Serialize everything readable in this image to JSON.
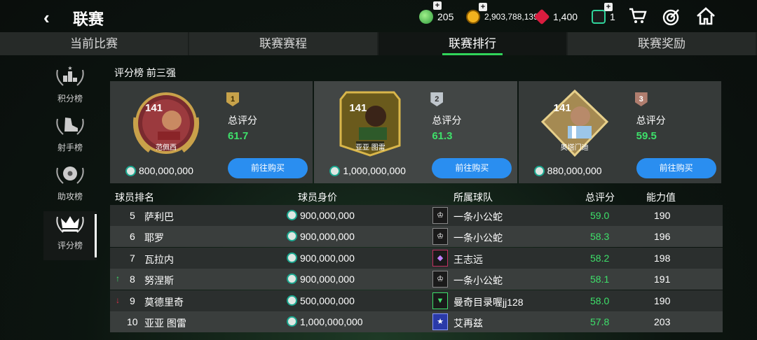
{
  "header": {
    "back_icon": "‹",
    "title": "联赛",
    "currencies": [
      {
        "icon": "gem-green-icon",
        "value": "205",
        "color": "#3fbf55"
      },
      {
        "icon": "coin-gold-icon",
        "value": "2,903,788,139",
        "color": "#e6a21a"
      },
      {
        "icon": "gem-red-icon",
        "value": "1,400",
        "color": "#e02244"
      },
      {
        "icon": "token-green-icon",
        "value": "1",
        "color": "#2fd39a"
      }
    ],
    "plus": "+"
  },
  "tabs": [
    {
      "label": "当前比赛"
    },
    {
      "label": "联赛赛程"
    },
    {
      "label": "联赛排行"
    },
    {
      "label": "联赛奖励"
    }
  ],
  "sidebar": [
    {
      "label": "积分榜",
      "icon": "podium-icon"
    },
    {
      "label": "射手榜",
      "icon": "boot-icon"
    },
    {
      "label": "助攻榜",
      "icon": "ball-icon"
    },
    {
      "label": "评分榜",
      "icon": "crown-icon"
    }
  ],
  "panel": {
    "title": "评分榜 前三强"
  },
  "top3": [
    {
      "rank": "1",
      "rating": "141",
      "name": "范佩西",
      "score_label": "总评分",
      "score": "61.7",
      "price": "800,000,000",
      "buy": "前往购买",
      "badge_color": "#c7a24a"
    },
    {
      "rank": "2",
      "rating": "141",
      "name": "亚亚 图雷",
      "score_label": "总评分",
      "score": "61.3",
      "price": "1,000,000,000",
      "buy": "前往购买",
      "badge_color": "#bfc6cc"
    },
    {
      "rank": "3",
      "rating": "141",
      "name": "奥塔门迪",
      "score_label": "总评分",
      "score": "59.5",
      "price": "880,000,000",
      "buy": "前往购买",
      "badge_color": "#b07d6e"
    }
  ],
  "table": {
    "headers": {
      "player": "球员排名",
      "value": "球员身价",
      "team": "所属球队",
      "score": "总评分",
      "ability": "能力值"
    },
    "rows": [
      {
        "rank": "5",
        "trend": "",
        "name": "萨利巴",
        "value": "900,000,000",
        "team": "一条小公蛇",
        "score": "59.0",
        "ability": "190"
      },
      {
        "rank": "6",
        "trend": "",
        "name": "耶罗",
        "value": "900,000,000",
        "team": "一条小公蛇",
        "score": "58.3",
        "ability": "196"
      },
      {
        "rank": "7",
        "trend": "",
        "name": "瓦拉内",
        "value": "900,000,000",
        "team": "王志远",
        "score": "58.2",
        "ability": "198"
      },
      {
        "rank": "8",
        "trend": "↑",
        "name": "努涅斯",
        "value": "900,000,000",
        "team": "一条小公蛇",
        "score": "58.1",
        "ability": "191"
      },
      {
        "rank": "9",
        "trend": "↓",
        "name": "莫德里奇",
        "value": "500,000,000",
        "team": "曼奇目录喔jj128",
        "score": "58.0",
        "ability": "190"
      },
      {
        "rank": "10",
        "trend": "",
        "name": "亚亚 图雷",
        "value": "1,000,000,000",
        "team": "艾再兹",
        "score": "57.8",
        "ability": "203"
      }
    ]
  }
}
